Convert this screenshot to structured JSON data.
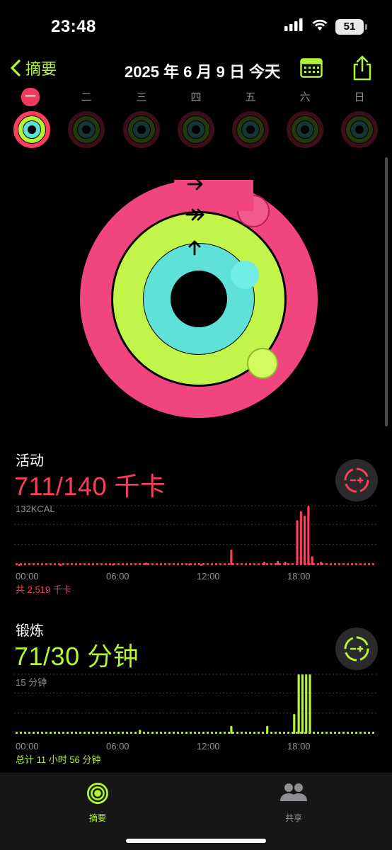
{
  "status_bar": {
    "time": "23:48",
    "battery": "51"
  },
  "nav": {
    "back_label": "摘要",
    "title": "2025 年 6 月 9 日 今天"
  },
  "week": {
    "days": [
      "一",
      "二",
      "三",
      "四",
      "五",
      "六",
      "日"
    ],
    "selected_index": 0
  },
  "rings": {
    "move": {
      "color": "#fa3e5c",
      "progress": 5.08
    },
    "exercise": {
      "color": "#b5f337",
      "progress": 2.37
    },
    "stand": {
      "color": "#5ce0d8",
      "progress": 0.92
    }
  },
  "move_section": {
    "label": "活动",
    "value": "711/140 千卡",
    "y_label": "132KCAL",
    "total": "共 2,519 千卡",
    "color": "#fa3e5c"
  },
  "exercise_section": {
    "label": "锻炼",
    "value": "71/30 分钟",
    "y_label": "15 分钟",
    "total": "总计 11 小时 56 分钟",
    "color": "#b5f337"
  },
  "x_axis": [
    "00:00",
    "06:00",
    "12:00",
    "18:00"
  ],
  "tabs": [
    {
      "label": "摘要",
      "active": true
    },
    {
      "label": "共享",
      "active": false
    }
  ],
  "chart_data": [
    {
      "type": "bar",
      "name": "move",
      "x": [
        0,
        1,
        2,
        3,
        4,
        5,
        6,
        7,
        8,
        9,
        10,
        11,
        12,
        13,
        14,
        15,
        16,
        17,
        18,
        19,
        20,
        21,
        22,
        23
      ],
      "xlim": [
        0,
        24
      ],
      "ylim": [
        0,
        132
      ],
      "y_label": "132KCAL",
      "bars": [
        {
          "x": 0.25,
          "v": 3
        },
        {
          "x": 3.0,
          "v": 3
        },
        {
          "x": 6.5,
          "v": 4
        },
        {
          "x": 8.7,
          "v": 6
        },
        {
          "x": 11.6,
          "v": 4
        },
        {
          "x": 12.4,
          "v": 3
        },
        {
          "x": 14.4,
          "v": 35
        },
        {
          "x": 16.6,
          "v": 8
        },
        {
          "x": 17.5,
          "v": 10
        },
        {
          "x": 18.0,
          "v": 8
        },
        {
          "x": 18.8,
          "v": 100
        },
        {
          "x": 19.05,
          "v": 120
        },
        {
          "x": 19.3,
          "v": 110
        },
        {
          "x": 19.55,
          "v": 132
        },
        {
          "x": 19.8,
          "v": 20
        },
        {
          "x": 20.4,
          "v": 8
        }
      ],
      "baseline_dots": true
    },
    {
      "type": "bar",
      "name": "exercise",
      "xlim": [
        0,
        24
      ],
      "ylim": [
        0,
        15
      ],
      "y_label": "15 分钟",
      "bars": [
        {
          "x": 8.3,
          "v": 1
        },
        {
          "x": 14.4,
          "v": 2
        },
        {
          "x": 16.8,
          "v": 2
        },
        {
          "x": 18.6,
          "v": 5
        },
        {
          "x": 18.9,
          "v": 15
        },
        {
          "x": 19.15,
          "v": 15
        },
        {
          "x": 19.4,
          "v": 15
        },
        {
          "x": 19.65,
          "v": 15
        }
      ],
      "baseline_dots": true
    }
  ]
}
